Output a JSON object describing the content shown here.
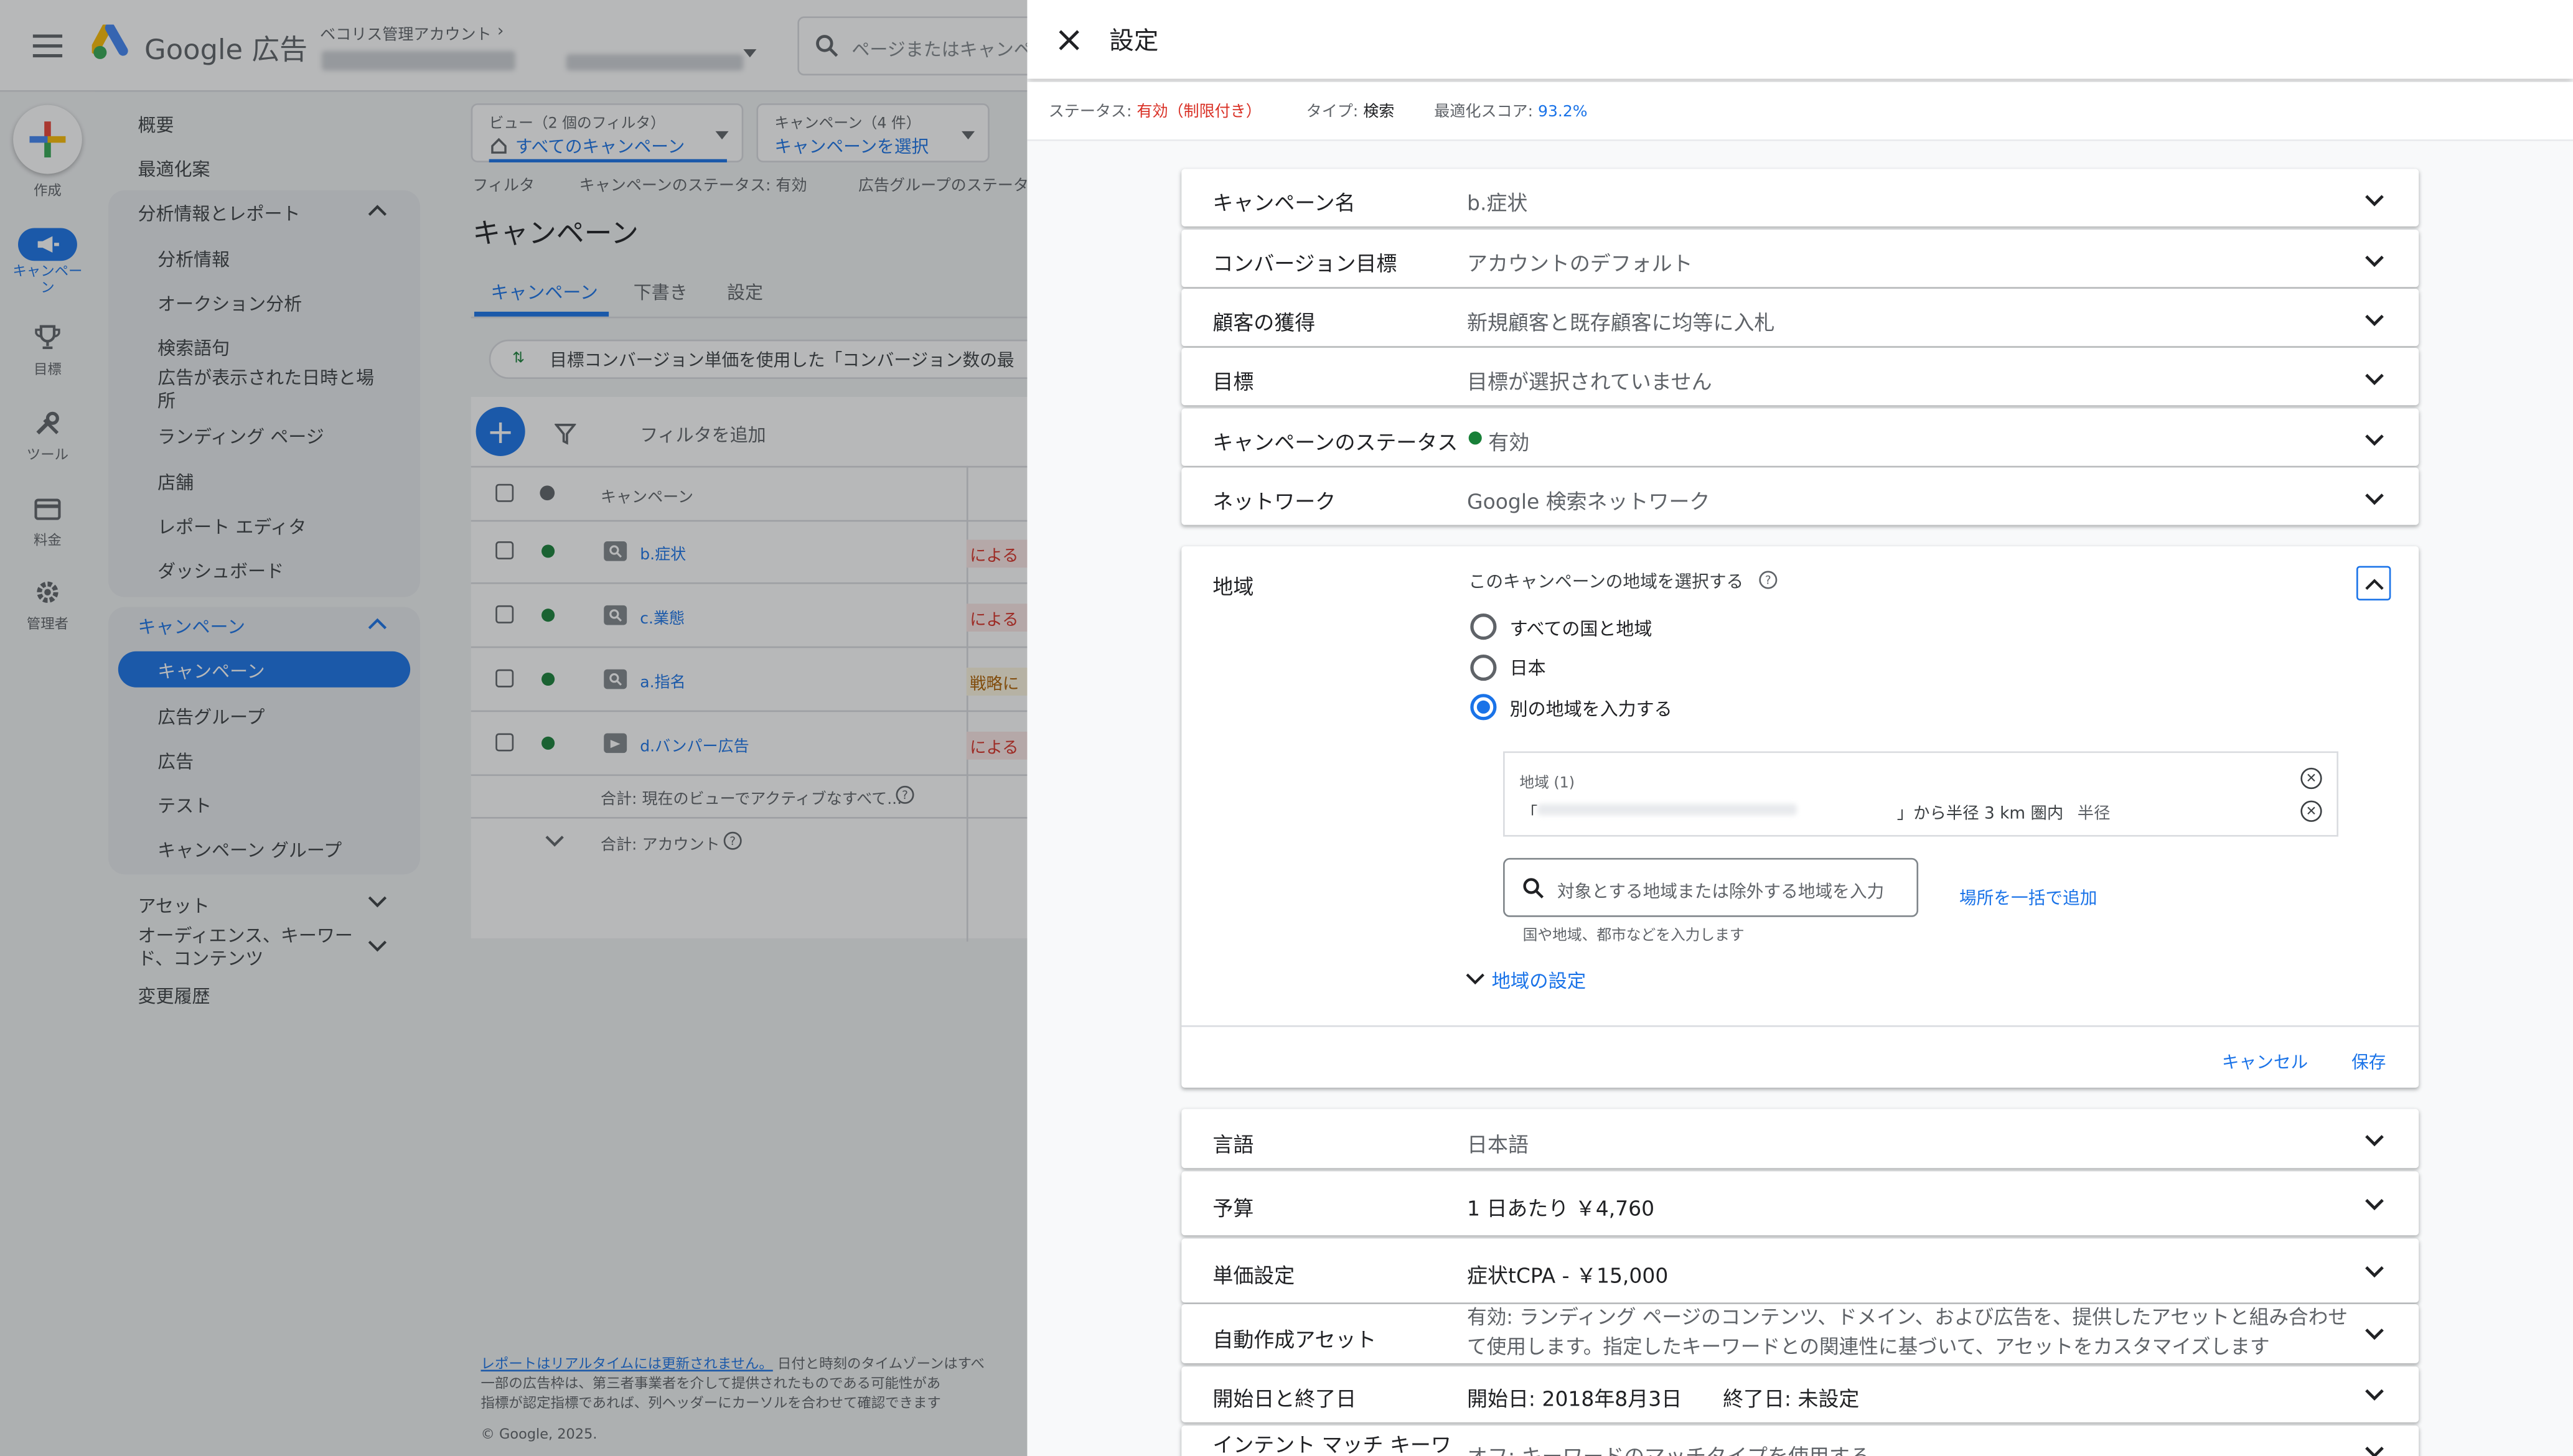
{
  "header": {
    "app_name": "Google 広告",
    "account_label": "ベコリス管理アカウント",
    "search_placeholder": "ページまたはキャンペ"
  },
  "rail": [
    {
      "label": "作成",
      "icon": "plus-icon"
    },
    {
      "label": "キャンペーン",
      "icon": "megaphone-icon"
    },
    {
      "label": "目標",
      "icon": "trophy-icon"
    },
    {
      "label": "ツール",
      "icon": "tools-icon"
    },
    {
      "label": "料金",
      "icon": "credit-card-icon"
    },
    {
      "label": "管理者",
      "icon": "gear-icon"
    }
  ],
  "nav": {
    "overview": "概要",
    "recommendations": "最適化案",
    "insights_group": "分析情報とレポート",
    "insights_items": [
      "分析情報",
      "オークション分析",
      "検索語句",
      "広告が表示された日時と場所",
      "ランディング ページ",
      "店舗",
      "レポート エディタ",
      "ダッシュボード"
    ],
    "campaigns_group": "キャンペーン",
    "campaigns_items": [
      "キャンペーン",
      "広告グループ",
      "広告",
      "テスト",
      "キャンペーン グループ"
    ],
    "assets": "アセット",
    "audiences": "オーディエンス、キーワード、コンテンツ",
    "change_history": "変更履歴"
  },
  "main": {
    "view_label": "ビュー（2 個のフィルタ）",
    "view_value": "すべてのキャンペーン",
    "campaign_filter_label": "キャンペーン（4 件）",
    "campaign_filter_value": "キャンペーンを選択",
    "filter_bar": [
      "フィルタ",
      "キャンペーンのステータス: 有効",
      "広告グループのステータ"
    ],
    "title": "キャンペーン",
    "tabs": [
      "キャンペーン",
      "下書き",
      "設定"
    ],
    "banner": "目標コンバージョン単価を使用した「コンバージョン数の最",
    "add_filter": "フィルタを追加",
    "col_campaign": "キャンペーン",
    "rows": [
      {
        "name": "b.症状",
        "status": "による"
      },
      {
        "name": "c.業態",
        "status": "による"
      },
      {
        "name": "a.指名",
        "status": "戦略に"
      },
      {
        "name": "d.バンパー広告",
        "status": "による"
      }
    ],
    "total_view": "合計: 現在のビューでアクティブなすべて...",
    "total_account": "合計: アカウント",
    "footer_link": "レポートはリアルタイムには更新されません。",
    "footer_text": " 日付と時刻のタイムゾーンはすべ",
    "footer_line2": "一部の広告枠は、第三者事業者を介して提供されたものである可能性があ",
    "footer_line3": "指標が認定指標であれば、列ヘッダーにカーソルを合わせて確認できます",
    "copyright": "© Google, 2025."
  },
  "panel": {
    "title": "設定",
    "status_label": "ステータス: ",
    "status_value": "有効（制限付き）",
    "type_label": "タイプ: ",
    "type_value": "検索",
    "score_label": "最適化スコア: ",
    "score_value": "93.2%",
    "rows_top": [
      {
        "label": "キャンペーン名",
        "value": "b.症状"
      },
      {
        "label": "コンバージョン目標",
        "value": "アカウントのデフォルト"
      },
      {
        "label": "顧客の獲得",
        "value": "新規顧客と既存顧客に均等に入札"
      },
      {
        "label": "目標",
        "value": "目標が選択されていません"
      },
      {
        "label": "キャンペーンのステータス",
        "value": "有効"
      },
      {
        "label": "ネットワーク",
        "value": "Google 検索ネットワーク"
      }
    ],
    "location": {
      "label": "地域",
      "question": "このキャンペーンの地域を選択する",
      "options": [
        "すべての国と地域",
        "日本",
        "別の地域を入力する"
      ],
      "selected": 2,
      "box_title": "地域 (1)",
      "entry_prefix": "「",
      "entry_suffix": "」から半径 3 km 圏内",
      "entry_type": "半径",
      "search_placeholder": "対象とする地域または除外する地域を入力",
      "bulk_add": "場所を一括で追加",
      "hint": "国や地域、都市などを入力します",
      "settings_link": "地域の設定",
      "cancel": "キャンセル",
      "save": "保存"
    },
    "rows_bottom": [
      {
        "label": "言語",
        "value": "日本語"
      },
      {
        "label": "予算",
        "value": "1 日あたり ￥4,760"
      },
      {
        "label": "単価設定",
        "value": "症状tCPA - ￥15,000"
      },
      {
        "label": "自動作成アセット",
        "value": "有効: ランディング ページのコンテンツ、ドメイン、および広告を、提供したアセットと組み合わせて使用します。指定したキーワードとの関連性に基づいて、アセットをカスタマイズします"
      },
      {
        "label": "開始日と終了日",
        "value": "開始日: 2018年8月3日　　終了日: 未設定"
      },
      {
        "label": "インテント マッチ キーワ",
        "value": "オフ: キーワードのマッチタイプを使用する"
      }
    ]
  },
  "colors": {
    "accent": "#1a73e8",
    "status_red": "#d93025",
    "status_green": "#188038",
    "scrim": "rgba(32,33,36,0.32)"
  }
}
